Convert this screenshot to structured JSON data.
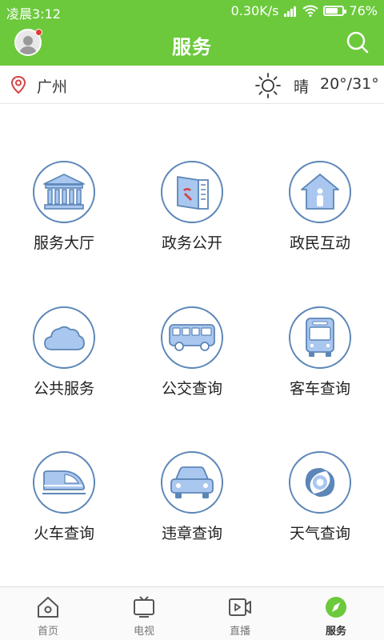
{
  "statusbar": {
    "time": "凌晨3:12",
    "speed": "0.30K/s",
    "battery": "76%",
    "battery_level": 0.76
  },
  "header": {
    "title": "服务"
  },
  "location": {
    "city": "广州",
    "weather": "晴",
    "temperature": "20°/31°"
  },
  "services": [
    {
      "label": "服务大厅",
      "icon": "government-hall-icon"
    },
    {
      "label": "政务公开",
      "icon": "party-document-icon"
    },
    {
      "label": "政民互动",
      "icon": "house-person-icon"
    },
    {
      "label": "公共服务",
      "icon": "cloud-icon"
    },
    {
      "label": "公交查询",
      "icon": "bus-side-icon"
    },
    {
      "label": "客车查询",
      "icon": "coach-front-icon"
    },
    {
      "label": "火车查询",
      "icon": "bullet-train-icon"
    },
    {
      "label": "违章查询",
      "icon": "car-icon"
    },
    {
      "label": "天气查询",
      "icon": "typhoon-icon"
    }
  ],
  "nav": [
    {
      "label": "首页",
      "icon": "home-icon"
    },
    {
      "label": "电视",
      "icon": "tv-icon"
    },
    {
      "label": "直播",
      "icon": "live-video-icon"
    },
    {
      "label": "服务",
      "icon": "compass-icon",
      "active": true
    }
  ],
  "colors": {
    "brand_green": "#6cc93c",
    "icon_blue": "#5c86b8",
    "icon_fill": "#a9c7ef"
  }
}
